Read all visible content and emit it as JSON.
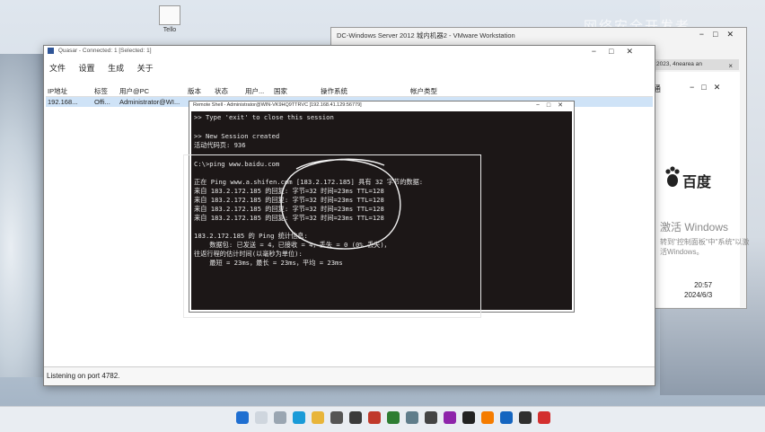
{
  "desktop": {
    "icon_label": "Tello",
    "watermark": "网络安全开发者"
  },
  "vmware": {
    "title": "DC-Windows Server 2012 城内机器2 - VMware Workstation",
    "tab_label": "2023, 4nearea an",
    "nav_label": "通",
    "baidu_text": "百度",
    "activate_line1": "激活 Windows",
    "activate_line2": "转到\"控制面板\"中\"系统\"以激活Windows。",
    "time": "20:57",
    "date": "2024/6/3"
  },
  "quasar": {
    "title": "Quasar - Connected: 1 [Selected: 1]",
    "menu": [
      "文件",
      "设置",
      "生成",
      "关于"
    ],
    "columns": [
      "IP地址",
      "标签",
      "用户@PC",
      "版本",
      "状态",
      "用户...",
      "国家",
      "操作系统",
      "帐户类型"
    ],
    "row": {
      "ip": "192.168...",
      "tag": "Offi...",
      "user_pc": "Administrator@WI..."
    },
    "status_text": "Listening on port 4782."
  },
  "shell": {
    "title": "Remote Shell - Administrator@WIN-VK9HQ9TTRVC [192.168.41.129:56779]",
    "lines": [
      ">> Type 'exit' to close this session",
      "",
      ">> New Session created",
      "活动代码页: 936",
      "",
      "C:\\>ping www.baidu.com",
      "",
      "正在 Ping www.a.shifen.com [183.2.172.185] 具有 32 字节的数据:",
      "来自 183.2.172.185 的回复: 字节=32 时间=23ms TTL=128",
      "来自 183.2.172.185 的回复: 字节=32 时间=23ms TTL=128",
      "来自 183.2.172.185 的回复: 字节=32 时间=23ms TTL=128",
      "来自 183.2.172.185 的回复: 字节=32 时间=23ms TTL=128",
      "",
      "183.2.172.185 的 Ping 统计信息:",
      "    数据包: 已发送 = 4，已接收 = 4，丢失 = 0 (0% 丢失)，",
      "往返行程的估计时间(以毫秒为单位):",
      "    最短 = 23ms，最长 = 23ms，平均 = 23ms"
    ]
  },
  "taskbar": {
    "icons": [
      "start-icon",
      "search-icon",
      "task-view-icon",
      "edge-icon",
      "folder-icon",
      "app-icon-1",
      "app-icon-2",
      "app-icon-3",
      "app-icon-4",
      "app-icon-5",
      "app-icon-6",
      "app-icon-7",
      "app-icon-8",
      "app-icon-9",
      "app-icon-10",
      "app-icon-11",
      "app-icon-12"
    ]
  }
}
